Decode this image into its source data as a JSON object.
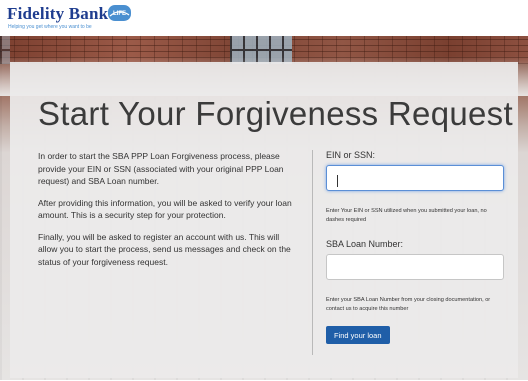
{
  "brand": {
    "name": "Fidelity Bank",
    "badge_text": "LIFE",
    "tagline": "Helping you get where you want to be",
    "colors": {
      "navy": "#1f3d8f",
      "accent": "#4a8fd0",
      "button": "#1f5ea8"
    }
  },
  "page": {
    "title": "Start Your Forgiveness Request",
    "paragraphs": [
      "In order to start the SBA PPP Loan Forgiveness process, please provide your EIN or SSN (associated with your original PPP Loan request) and SBA Loan number.",
      "After providing this information, you will be asked to verify your loan amount. This is a security step for your protection.",
      "Finally, you will be asked to register an account with us. This will allow you to start the process, send us messages and check on the status of your forgiveness request."
    ]
  },
  "form": {
    "ein": {
      "label": "EIN or SSN:",
      "value": "",
      "help": "Enter Your EIN or SSN utilized when you submitted your loan, no dashes required"
    },
    "sba": {
      "label": "SBA Loan Number:",
      "value": "",
      "help": "Enter your SBA Loan Number from your closing documentation, or contact us to acquire this number"
    },
    "submit_label": "Find your loan"
  }
}
